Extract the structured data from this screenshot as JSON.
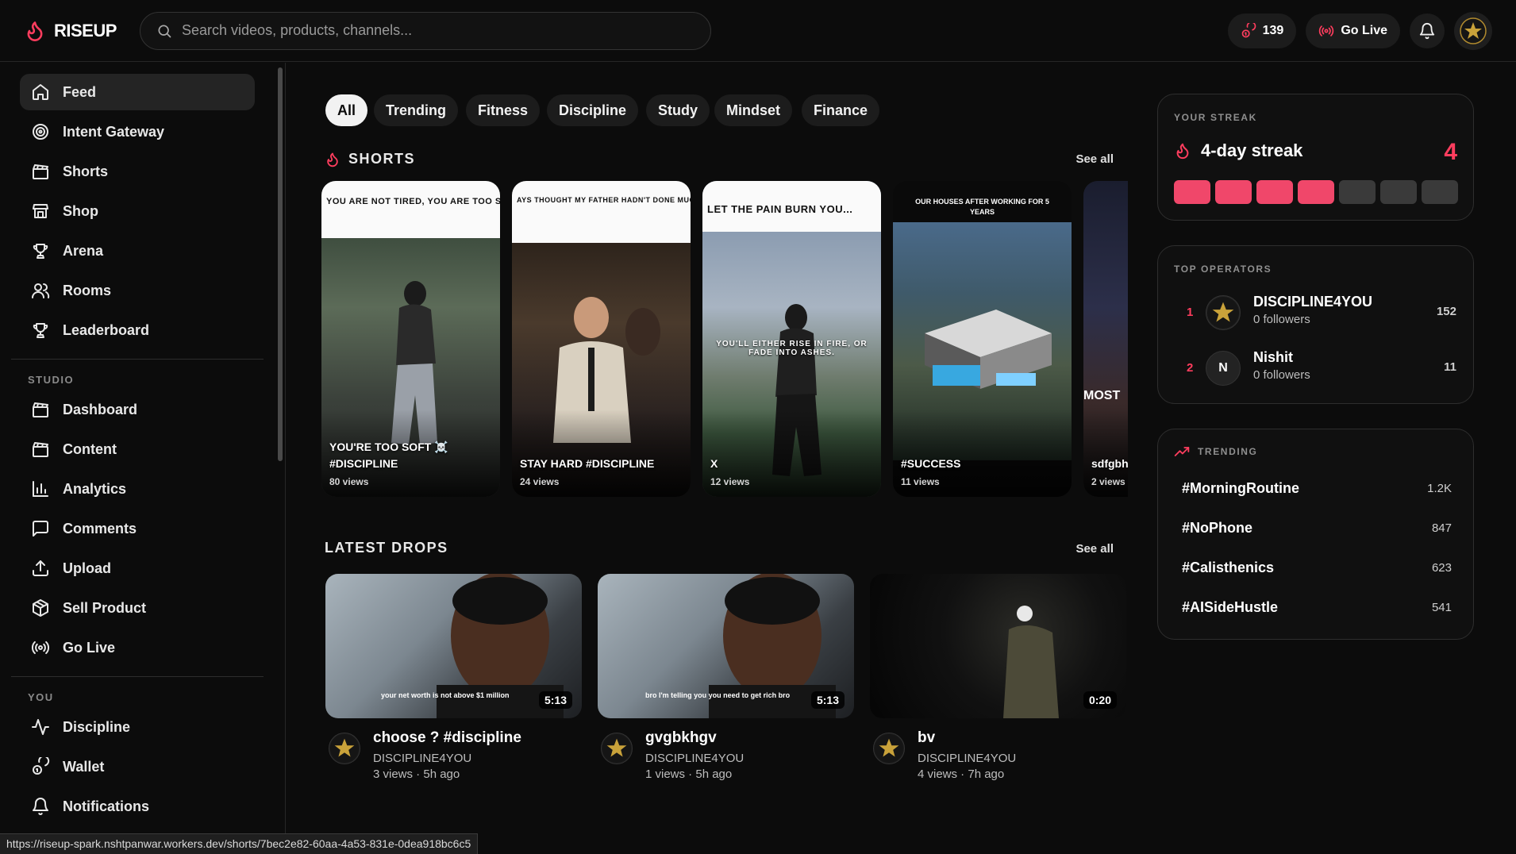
{
  "app": {
    "name": "RISEUP"
  },
  "search": {
    "placeholder": "Search videos, products, channels..."
  },
  "topbar": {
    "points": "139",
    "go_live": "Go Live"
  },
  "sidebar": {
    "main": [
      {
        "label": "Feed",
        "icon": "home-icon"
      },
      {
        "label": "Intent Gateway",
        "icon": "target-icon"
      },
      {
        "label": "Shorts",
        "icon": "clapperboard-icon"
      },
      {
        "label": "Shop",
        "icon": "store-icon"
      },
      {
        "label": "Arena",
        "icon": "trophy-icon"
      },
      {
        "label": "Rooms",
        "icon": "users-icon"
      },
      {
        "label": "Leaderboard",
        "icon": "trophy-icon"
      }
    ],
    "studio_label": "STUDIO",
    "studio": [
      {
        "label": "Dashboard",
        "icon": "clapperboard-icon"
      },
      {
        "label": "Content",
        "icon": "clapperboard-icon"
      },
      {
        "label": "Analytics",
        "icon": "bar-chart-icon"
      },
      {
        "label": "Comments",
        "icon": "message-square-icon"
      },
      {
        "label": "Upload",
        "icon": "upload-icon"
      },
      {
        "label": "Sell Product",
        "icon": "package-icon"
      },
      {
        "label": "Go Live",
        "icon": "radio-icon"
      }
    ],
    "you_label": "YOU",
    "you": [
      {
        "label": "Discipline",
        "icon": "activity-icon"
      },
      {
        "label": "Wallet",
        "icon": "coins-icon"
      },
      {
        "label": "Notifications",
        "icon": "bell-icon"
      }
    ]
  },
  "filters": [
    "All",
    "Trending",
    "Fitness",
    "Discipline",
    "Study",
    "Mindset",
    "Finance"
  ],
  "shorts": {
    "heading": "SHORTS",
    "see_all": "See all",
    "items": [
      {
        "caption": "YOU ARE NOT TIRED, YOU ARE TOO SOFT TO HANDEL DISCIPLINE",
        "title": "YOU'RE TOO SOFT ☠️ #DISCIPLINE",
        "views": "80 views"
      },
      {
        "caption": "AYS THOUGHT MY FATHER HADN'T DONE MUCH UNTIL I REALIZED HE HAD SACRIFICED EVERY WITHOUT TELLING ME. SO I ASKED HIM... \"DAD...",
        "title": "STAY HARD #DISCIPLINE",
        "views": "24 views"
      },
      {
        "caption": "LET THE PAIN BURN YOU...",
        "overlay": "YOU'LL EITHER RISE IN FIRE, OR FADE INTO ASHES.",
        "title": "X",
        "views": "12 views"
      },
      {
        "caption": "OUR HOUSES AFTER WORKING FOR 5 YEARS",
        "title": "#SUCCESS",
        "views": "11 views"
      },
      {
        "overlay": "MOST",
        "title": "sdfgbh",
        "views": "2 views"
      }
    ]
  },
  "latest": {
    "heading": "LATEST DROPS",
    "see_all": "See all",
    "items": [
      {
        "title": "choose ? #discipline",
        "channel": "DISCIPLINE4YOU",
        "stats": "3 views · 5h ago",
        "duration": "5:13",
        "overlay": "your net worth is not above $1 million"
      },
      {
        "title": "gvgbkhgv",
        "channel": "DISCIPLINE4YOU",
        "stats": "1 views · 5h ago",
        "duration": "5:13",
        "overlay": "bro I'm telling you you need to get rich bro"
      },
      {
        "title": "bv",
        "channel": "DISCIPLINE4YOU",
        "stats": "4 views · 7h ago",
        "duration": "0:20"
      }
    ]
  },
  "streak": {
    "label": "YOUR STREAK",
    "title": "4-day streak",
    "count": "4",
    "days_total": 7,
    "days_done": 4
  },
  "operators": {
    "label": "TOP OPERATORS",
    "items": [
      {
        "rank": "1",
        "name": "DISCIPLINE4YOU",
        "sub": "0 followers",
        "score": "152",
        "initial": ""
      },
      {
        "rank": "2",
        "name": "Nishit",
        "sub": "0 followers",
        "score": "11",
        "initial": "N"
      }
    ]
  },
  "trending": {
    "label": "TRENDING",
    "items": [
      {
        "tag": "#MorningRoutine",
        "count": "1.2K"
      },
      {
        "tag": "#NoPhone",
        "count": "847"
      },
      {
        "tag": "#Calisthenics",
        "count": "623"
      },
      {
        "tag": "#AISideHustle",
        "count": "541"
      }
    ]
  },
  "status_url": "https://riseup-spark.nshtpanwar.workers.dev/shorts/7bec2e82-60aa-4a53-831e-0dea918bc6c5",
  "colors": {
    "accent": "#f0476a",
    "background": "#0c0c0c"
  }
}
